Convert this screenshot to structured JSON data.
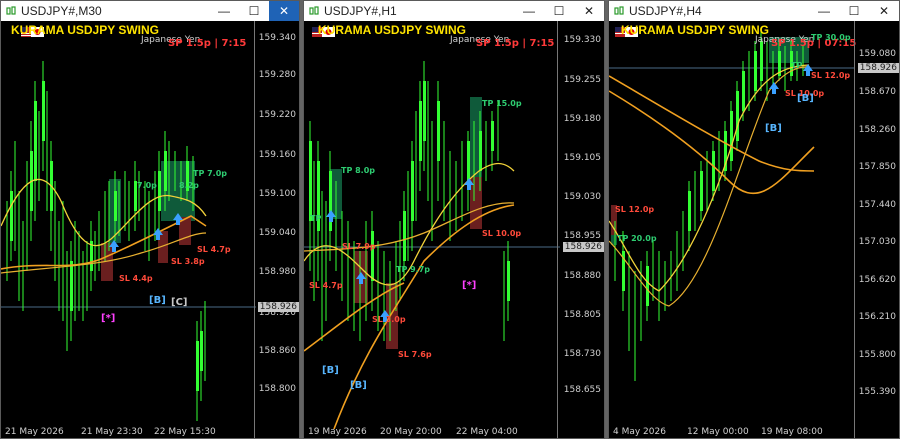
{
  "windows": [
    {
      "title": "USDJPY#,M30",
      "brand": "KURAMA USDJPY SWING",
      "symbol_desc": "Japanese Yen",
      "spread": "SP 1.5p  |  7:15",
      "prices": [
        "159.340",
        "159.280",
        "159.220",
        "159.160",
        "159.100",
        "159.040",
        "158.980",
        "158.920",
        "158.860",
        "158.800"
      ],
      "current_price": "158.926",
      "dates": [
        "21 May 2026",
        "21 May 23:30",
        "22 May 15:30"
      ],
      "labels": [
        "TP 7.0p",
        "7.0p",
        "8.2p",
        "SL 4.7p",
        "SL 3.8p",
        "SL 4.4p"
      ],
      "tags": [
        "[B]",
        "[C]",
        "[*]"
      ]
    },
    {
      "title": "USDJPY#,H1",
      "brand": "KURAMA USDJPY SWING",
      "symbol_desc": "Japanese Yen",
      "spread": "SP 1.5p  |  7:15",
      "prices": [
        "159.330",
        "159.255",
        "159.180",
        "159.105",
        "159.030",
        "158.955",
        "158.880",
        "158.805",
        "158.730",
        "158.655"
      ],
      "current_price": "158.926",
      "dates": [
        "19 May 2026",
        "20 May 20:00",
        "22 May 04:00"
      ],
      "labels": [
        "TP 15.0p",
        "TP 8.0p",
        "TP",
        "TP 9.7p",
        "SL 10.0p",
        "SL 4.7p",
        "SL 7.6p",
        "SL 7.9p",
        "SL 3.0p"
      ],
      "tags": [
        "[B]",
        "[B]",
        "[*]"
      ]
    },
    {
      "title": "USDJPY#,H4",
      "brand": "KURAMA USDJPY SWING",
      "symbol_desc": "Japanese Yen",
      "spread": "SP 1.5p  |  07:15",
      "prices": [
        "159.080",
        "158.670",
        "158.260",
        "157.850",
        "157.440",
        "157.030",
        "156.620",
        "156.210",
        "155.800",
        "155.390"
      ],
      "current_price": "158.926",
      "dates": [
        "4 May 2026",
        "12 May 00:00",
        "19 May 08:00"
      ],
      "labels": [
        "TP 30.0p",
        "TP",
        "SL 12.0p",
        "SL 12.0p",
        "SL 10.0p",
        "TP 20.0p"
      ],
      "tags": [
        "[B]",
        "[B]"
      ]
    }
  ],
  "controls": {
    "minimize": "—",
    "maximize": "☐",
    "close": "✕"
  },
  "colors": {
    "bull": "#33ff33",
    "bull_dark": "#1a8a1a",
    "ma_yellow": "#f2d23a",
    "ma_orange": "#f0a020",
    "zone_tp": "#0f5a3a",
    "zone_sl": "#6a1f1f",
    "arrow": "#3aa0ff"
  }
}
